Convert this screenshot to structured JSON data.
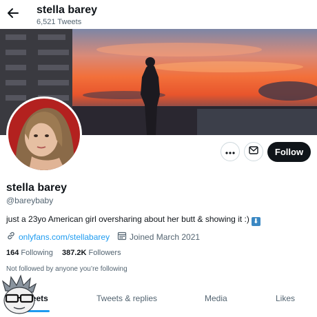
{
  "header": {
    "back_icon": "arrow-left-icon",
    "name": "stella barey",
    "tweet_count": "6,521 Tweets"
  },
  "actions": {
    "more_icon": "more-dots-icon",
    "message_icon": "mail-icon",
    "follow_label": "Follow"
  },
  "profile": {
    "name": "stella barey",
    "handle": "@bareybaby",
    "bio": "just a 23yo American girl oversharing about her butt & showing it :)",
    "bio_emoji": "⬇",
    "link": "onlyfans.com/stellabarey",
    "joined": "Joined March 2021",
    "following_count": "164",
    "following_label": "Following",
    "followers_count": "387.2K",
    "followers_label": "Followers",
    "not_followed": "Not followed by anyone you’re following"
  },
  "tabs": [
    {
      "label": "Tweets"
    },
    {
      "label": "Tweets & replies"
    },
    {
      "label": "Media"
    },
    {
      "label": "Likes"
    }
  ],
  "colors": {
    "accent": "#1d9bf0",
    "follow_button": "#0f1419",
    "secondary_text": "#536471"
  }
}
